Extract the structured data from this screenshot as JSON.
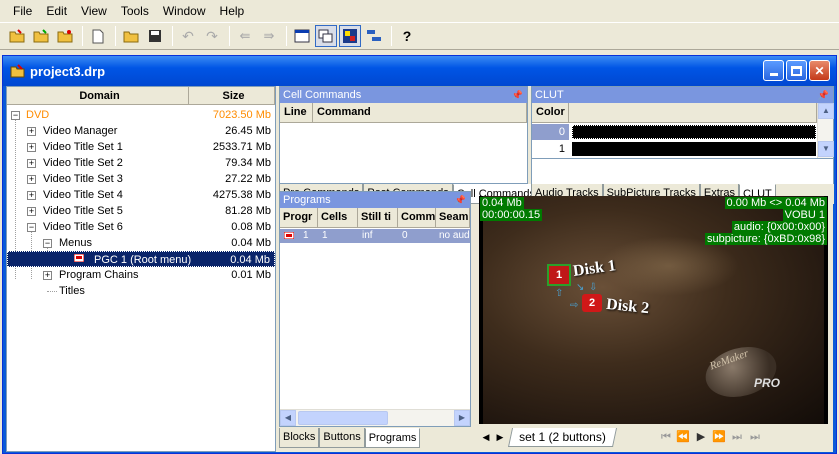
{
  "menu": {
    "items": [
      "File",
      "Edit",
      "View",
      "Tools",
      "Window",
      "Help"
    ]
  },
  "window": {
    "title": "project3.drp"
  },
  "domain_panel": {
    "col_domain": "Domain",
    "col_size": "Size",
    "rows": [
      {
        "name": "DVD",
        "size": "7023.50 Mb"
      },
      {
        "name": "Video Manager",
        "size": "26.45 Mb"
      },
      {
        "name": "Video Title Set 1",
        "size": "2533.71 Mb"
      },
      {
        "name": "Video Title Set 2",
        "size": "79.34 Mb"
      },
      {
        "name": "Video Title Set 3",
        "size": "27.22 Mb"
      },
      {
        "name": "Video Title Set 4",
        "size": "4275.38 Mb"
      },
      {
        "name": "Video Title Set 5",
        "size": "81.28 Mb"
      },
      {
        "name": "Video Title Set 6",
        "size": "0.08 Mb"
      },
      {
        "name": "Menus",
        "size": "0.04 Mb"
      },
      {
        "name": "PGC 1 (Root menu)",
        "size": "0.04 Mb"
      },
      {
        "name": "Program Chains",
        "size": "0.01 Mb"
      },
      {
        "name": "Titles",
        "size": ""
      }
    ]
  },
  "cell_commands": {
    "title": "Cell Commands",
    "col_line": "Line",
    "col_command": "Command",
    "tabs": [
      "Pre Commands",
      "Post Commands",
      "Cell Commands"
    ]
  },
  "clut": {
    "title": "CLUT",
    "col_color": "Color",
    "rows": [
      "0",
      "1"
    ],
    "tabs": [
      "Audio Tracks",
      "SubPicture Tracks",
      "Extras",
      "CLUT"
    ]
  },
  "programs": {
    "title": "Programs",
    "cols": [
      "Progr",
      "Cells",
      "Still ti",
      "Comm",
      "Seam"
    ],
    "row": [
      "1",
      "1",
      "inf",
      "0",
      "no aud"
    ],
    "tabs": [
      "Blocks",
      "Buttons",
      "Programs"
    ]
  },
  "preview": {
    "tl1": "0.04 Mb",
    "tl2": "00:00:00.15",
    "tr1": "0.00 Mb <> 0.04 Mb",
    "tr2": "VOBU 1",
    "tr3": "audio: {0x00:0x00}",
    "tr4": "subpicture: {0xBD:0x98}",
    "btn1": "1",
    "btn2": "2",
    "disk1": "Disk 1",
    "disk2": "Disk 2",
    "logo": "ReMaker",
    "logo2": "PRO"
  },
  "nav": {
    "set_tab": "set 1 (2 buttons)"
  },
  "colors": {
    "title_blue": "#0055e5",
    "panel_title": "#7a96df",
    "selected": "#0a246a",
    "dvd_orange": "#ff8c00",
    "overlay_green": "#007a00"
  }
}
